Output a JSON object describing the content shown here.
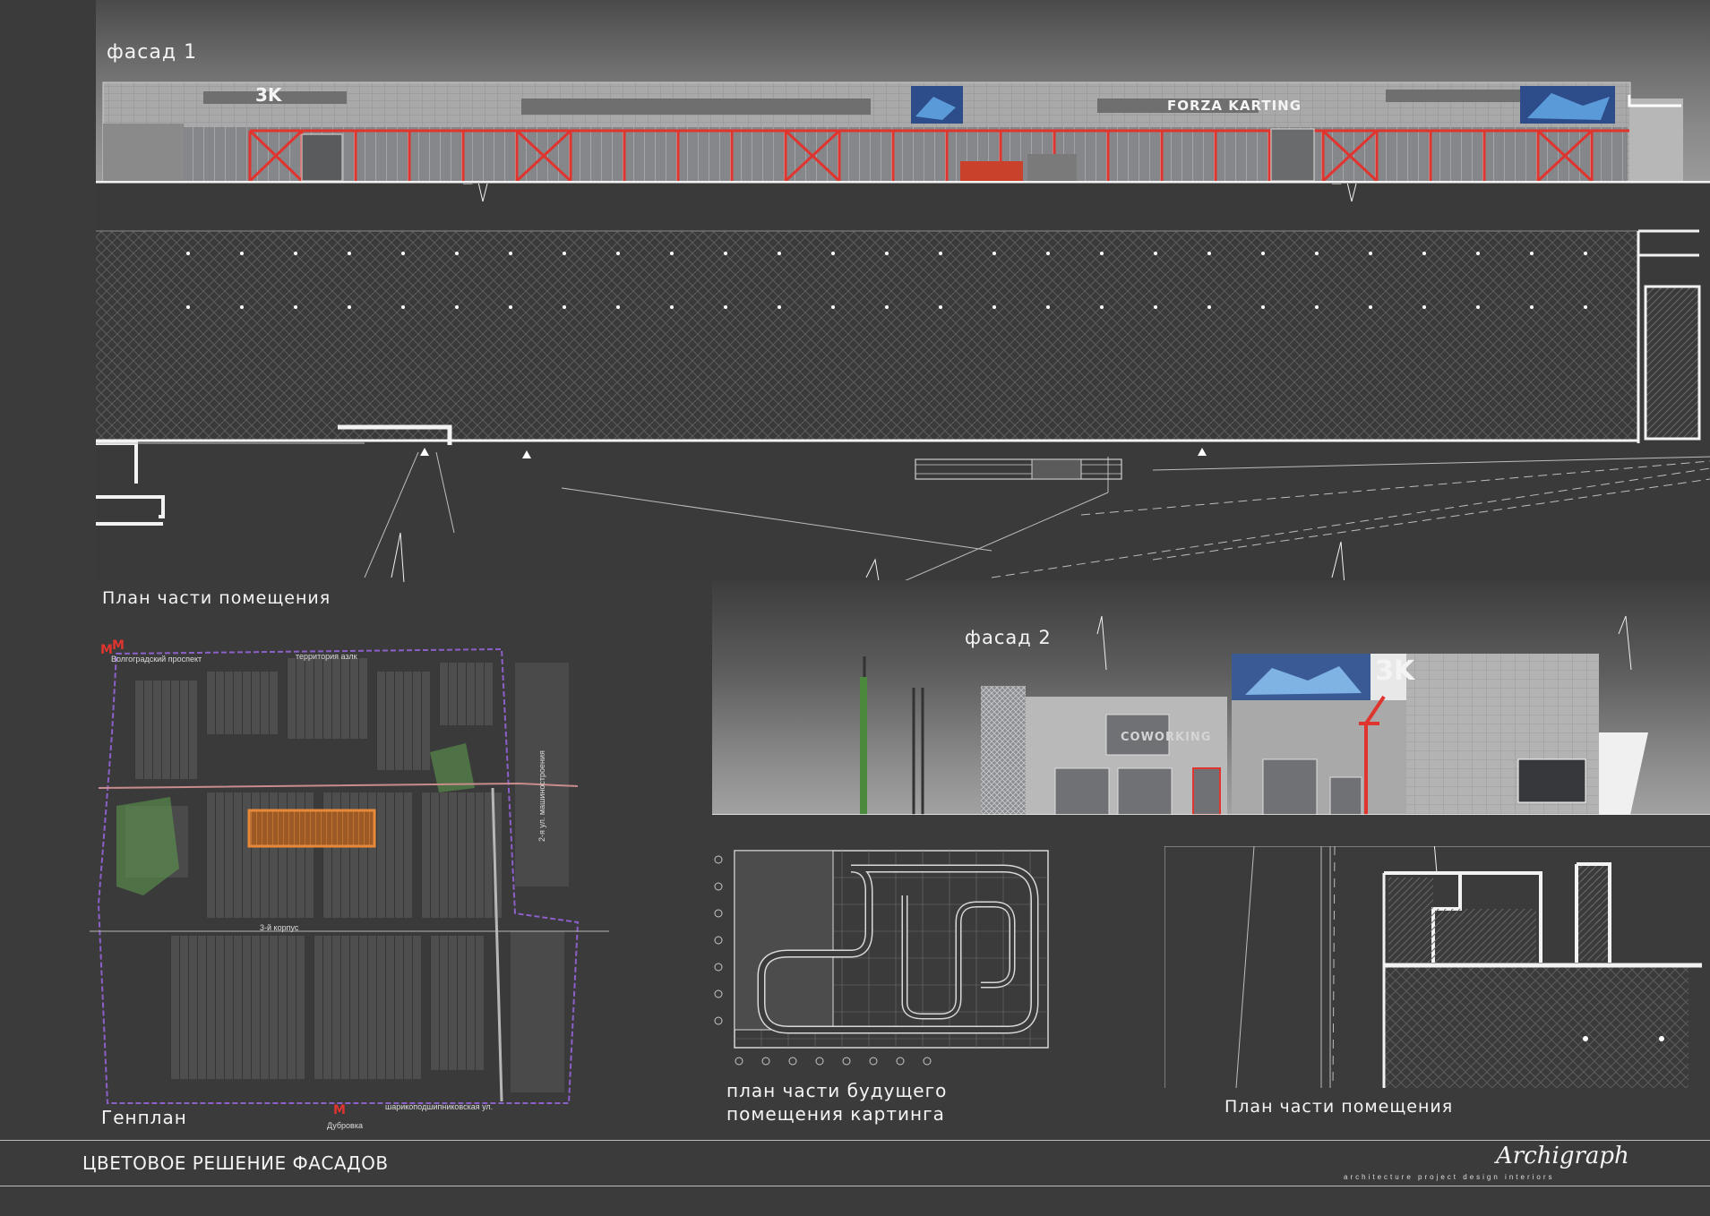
{
  "facade1": {
    "title": "фасад 1",
    "sign_3k": "3K",
    "sign_forza": "FORZA KARTING"
  },
  "plan1": {
    "caption": "План части помещения"
  },
  "facade2": {
    "title": "фасад 2",
    "sign_3k": "3K",
    "sign_coworking": "COWORKING"
  },
  "genplan": {
    "caption": "Генплан",
    "metro_top": "Волгоградский проспект",
    "territory": "территория азлк",
    "street_right": "2-я ул. машиностроения",
    "building": "3-й корпус",
    "street_bottom": "шарикоподшипниковская ул.",
    "metro_bottom": "Дубровка",
    "metro_symbol": "M"
  },
  "karting": {
    "caption_line1": "план части будущего",
    "caption_line2": "помещения картинга"
  },
  "plan3": {
    "caption": "План части помещения"
  },
  "footer": {
    "title": "ЦВЕТОВОЕ РЕШЕНИЕ ФАСАДОВ",
    "logo": "Archigraph",
    "tagline": "architecture   project   design   interiors"
  },
  "colors": {
    "background": "#3b3b3c",
    "facade_red": "#e0342f",
    "orange_highlight": "#e8893a",
    "purple_boundary": "#8d5fc9",
    "green_park": "#5ea04e",
    "line_white": "#f2f2f2"
  }
}
